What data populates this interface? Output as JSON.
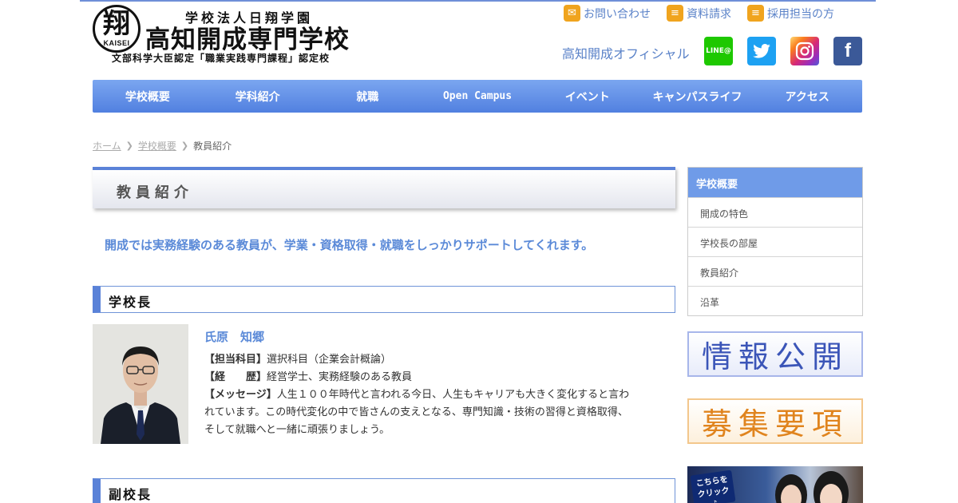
{
  "header": {
    "logo_kanji": "翔",
    "logo_latin": "KAISEI",
    "org_name": "学校法人日翔学園",
    "school_name": "高知開成専門学校",
    "certification": "文部科学大臣認定「職業実践専門課程」認定校",
    "top_links": [
      {
        "label": "お問い合わせ",
        "icon": "mail-icon"
      },
      {
        "label": "資料請求",
        "icon": "document-icon"
      },
      {
        "label": "採用担当の方",
        "icon": "document-icon"
      }
    ],
    "official_label": "高知開成オフィシャル",
    "sns": [
      {
        "name": "line",
        "label": "LINE@"
      },
      {
        "name": "twitter",
        "label": "twitter"
      },
      {
        "name": "instagram",
        "label": "instagram"
      },
      {
        "name": "facebook",
        "label": "f"
      }
    ]
  },
  "nav": {
    "items": [
      "学校概要",
      "学科紹介",
      "就職",
      "Open Campus",
      "イベント",
      "キャンパスライフ",
      "アクセス"
    ]
  },
  "breadcrumb": {
    "home": "ホーム",
    "parent": "学校概要",
    "current": "教員紹介"
  },
  "page": {
    "title": "教員紹介",
    "lead": "開成では実務経験のある教員が、学業・資格取得・就職をしっかりサポートしてくれます。"
  },
  "sections": [
    {
      "heading": "学校長",
      "staff": {
        "name": "氏原　知郷",
        "subject_label": "【担当科目】",
        "subject": "選択科目（企業会計概論）",
        "career_label": "【経　　歴】",
        "career": "経営学士、実務経験のある教員",
        "message_label": "【メッセージ】",
        "message": "人生１００年時代と言われる今日、人生もキャリアも大きく変化すると言われています。この時代変化の中で皆さんの支えとなる、専門知識・技術の習得と資格取得、そして就職へと一緒に頑張りましょう。"
      }
    },
    {
      "heading": "副校長"
    }
  ],
  "sidebar": {
    "heading": "学校概要",
    "items": [
      "開成の特色",
      "学校長の部屋",
      "教員紹介",
      "沿革"
    ],
    "banner_info": "情報公開",
    "banner_recruit": "募集要項",
    "banner_click": "こちらをクリック♪"
  },
  "colors": {
    "accent": "#5a82d8",
    "link": "#5a82c8",
    "nav_top": "#7ba6f0",
    "nav_bottom": "#5180e0",
    "recruit": "#e0841e",
    "info": "#3b55b8"
  }
}
